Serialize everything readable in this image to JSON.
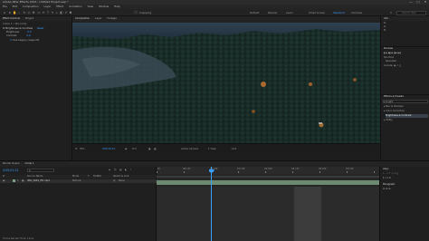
{
  "app": {
    "title": "Adobe After Effects 2023 - Untitled Project.aep *",
    "window_controls": [
      "—",
      "□",
      "✕"
    ]
  },
  "menu": [
    "File",
    "Edit",
    "Composition",
    "Layer",
    "Effect",
    "Animation",
    "View",
    "Window",
    "Help"
  ],
  "toolbar": {
    "workspaces": [
      "Default",
      "Review",
      "Learn",
      "Small Screen",
      "Standard",
      "Libraries"
    ],
    "active_workspace": "Standard",
    "search_placeholder": "Search Help",
    "snapping_label": "Snapping"
  },
  "left_panel": {
    "tabs": [
      "Effect Controls",
      "Project"
    ],
    "rows": [
      {
        "label": "Comp 1 • Pre-comp",
        "indent": 0,
        "accent": false
      },
      {
        "label": "fx  Brightness & Contrast",
        "value": "Reset",
        "indent": 0,
        "accent": true
      },
      {
        "label": "Brightness",
        "value": "0.0",
        "indent": 2,
        "accent": false
      },
      {
        "label": "Contrast",
        "value": "0.0",
        "indent": 2,
        "accent": false
      },
      {
        "label": "Use Legacy (supports",
        "indent": 4,
        "accent": false
      }
    ]
  },
  "viewer": {
    "tabs": [
      "Composition",
      "Layer",
      "Footage"
    ],
    "footer": {
      "zoom": "50%",
      "timecode": "0;00;01;12",
      "resolution": "Full",
      "camera": "Active Camera",
      "views": "1 View",
      "exposure": "+0.0"
    }
  },
  "right_panel": {
    "sections": [
      {
        "title": "Info",
        "rows": [
          "R:",
          "G:",
          "B:"
        ]
      },
      {
        "title": "Preview",
        "rows": [
          "▮◀  ◀▮  ▶  ▮▶  ▶▮",
          "Shortcut",
          "Spacebar",
          "Include: ◉ ♪ ▢"
        ]
      },
      {
        "title": "Effects & Presets",
        "rows": [
          "ρ  bright",
          "▸ Blur & Sharpen",
          "▸ Color Correction",
          "  Brightness & Contrast",
          "▸ Utility"
        ]
      }
    ]
  },
  "timeline": {
    "tabs": [
      "Render Queue",
      "Comp 1"
    ],
    "timecode": "0;00;01;12",
    "search_placeholder": "ρ",
    "columns": [
      "#",
      "Source Name",
      "Mode",
      "T",
      "TrkMat",
      "Parent & Link"
    ],
    "layers": [
      {
        "index": "1",
        "name": "IMG_5629_HD.mp4",
        "mode": "Normal",
        "parent": "None"
      }
    ],
    "ruler": [
      "0f",
      "00:15f",
      "01:00f",
      "01:15f",
      "02:00f",
      "02:15f",
      "03:00f",
      "03:15f"
    ],
    "status": "Frame Render Time: 11ms",
    "right_tabs": [
      "Align",
      "Paragraph"
    ]
  },
  "colors": {
    "accent": "#3aa0ff",
    "layer_bar": "#6c8a70",
    "label_green": "#7aa07f"
  }
}
